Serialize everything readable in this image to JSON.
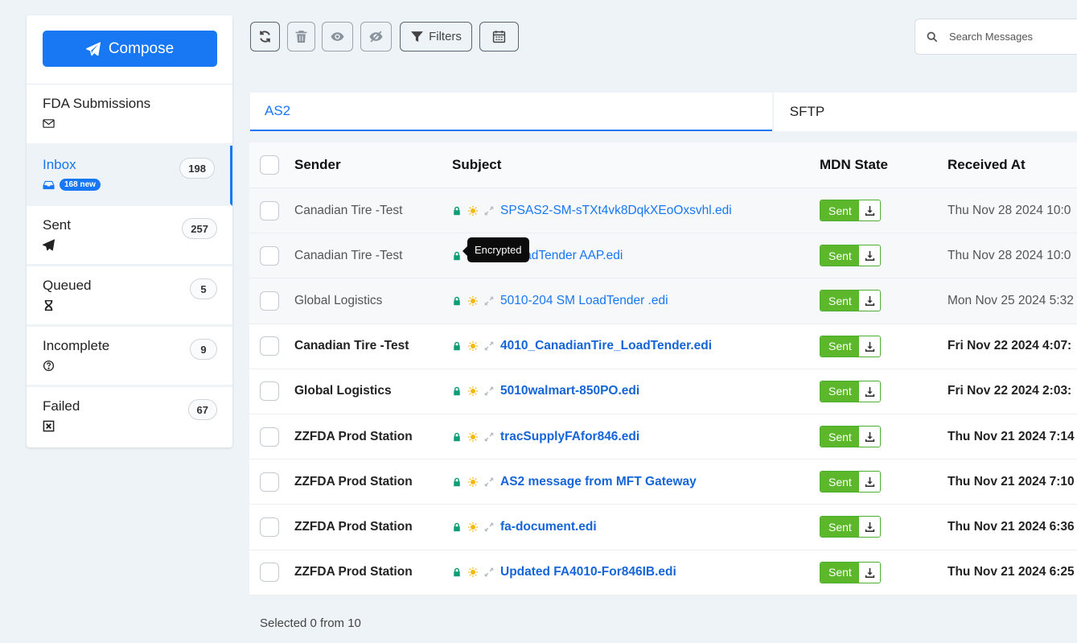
{
  "sidebar": {
    "compose_label": "Compose",
    "folders": [
      {
        "name": "FDA Submissions"
      },
      {
        "name": "Inbox",
        "count": "198",
        "new_badge": "168 new"
      },
      {
        "name": "Sent",
        "count": "257"
      },
      {
        "name": "Queued",
        "count": "5"
      },
      {
        "name": "Incomplete",
        "count": "9"
      },
      {
        "name": "Failed",
        "count": "67"
      }
    ]
  },
  "toolbar": {
    "filters_label": "Filters",
    "search_placeholder": "Search Messages"
  },
  "tabs": [
    "AS2",
    "SFTP"
  ],
  "table": {
    "headers": {
      "sender": "Sender",
      "subject": "Subject",
      "mdn": "MDN State",
      "received": "Received At"
    },
    "rows": [
      {
        "sender": "Canadian Tire -Test",
        "subject": "SPSAS2-SM-sTXt4vk8DqkXEoOxsvhl.edi",
        "mdn": "Sent",
        "received": "Thu Nov 28 2024 10:0"
      },
      {
        "sender": "Canadian Tire -Test",
        "subject": "0 LoadTender AAP.edi",
        "mdn": "Sent",
        "received": "Thu Nov 28 2024 10:0"
      },
      {
        "sender": "Global Logistics",
        "subject": "5010-204 SM LoadTender .edi",
        "mdn": "Sent",
        "received": "Mon Nov 25 2024 5:32"
      },
      {
        "sender": "Canadian Tire -Test",
        "subject": "4010_CanadianTire_LoadTender.edi",
        "mdn": "Sent",
        "received": "Fri Nov 22 2024 4:07:"
      },
      {
        "sender": "Global Logistics",
        "subject": "5010walmart-850PO.edi",
        "mdn": "Sent",
        "received": "Fri Nov 22 2024 2:03:"
      },
      {
        "sender": "ZZFDA Prod Station",
        "subject": "tracSupplyFAfor846.edi",
        "mdn": "Sent",
        "received": "Thu Nov 21 2024 7:14"
      },
      {
        "sender": "ZZFDA Prod Station",
        "subject": "AS2 message from MFT Gateway",
        "mdn": "Sent",
        "received": "Thu Nov 21 2024 7:10"
      },
      {
        "sender": "ZZFDA Prod Station",
        "subject": "fa-document.edi",
        "mdn": "Sent",
        "received": "Thu Nov 21 2024 6:36"
      },
      {
        "sender": "ZZFDA Prod Station",
        "subject": "Updated FA4010-For846IB.edi",
        "mdn": "Sent",
        "received": "Thu Nov 21 2024 6:25"
      }
    ]
  },
  "tooltip": "Encrypted",
  "footer": "Selected 0 from 10"
}
